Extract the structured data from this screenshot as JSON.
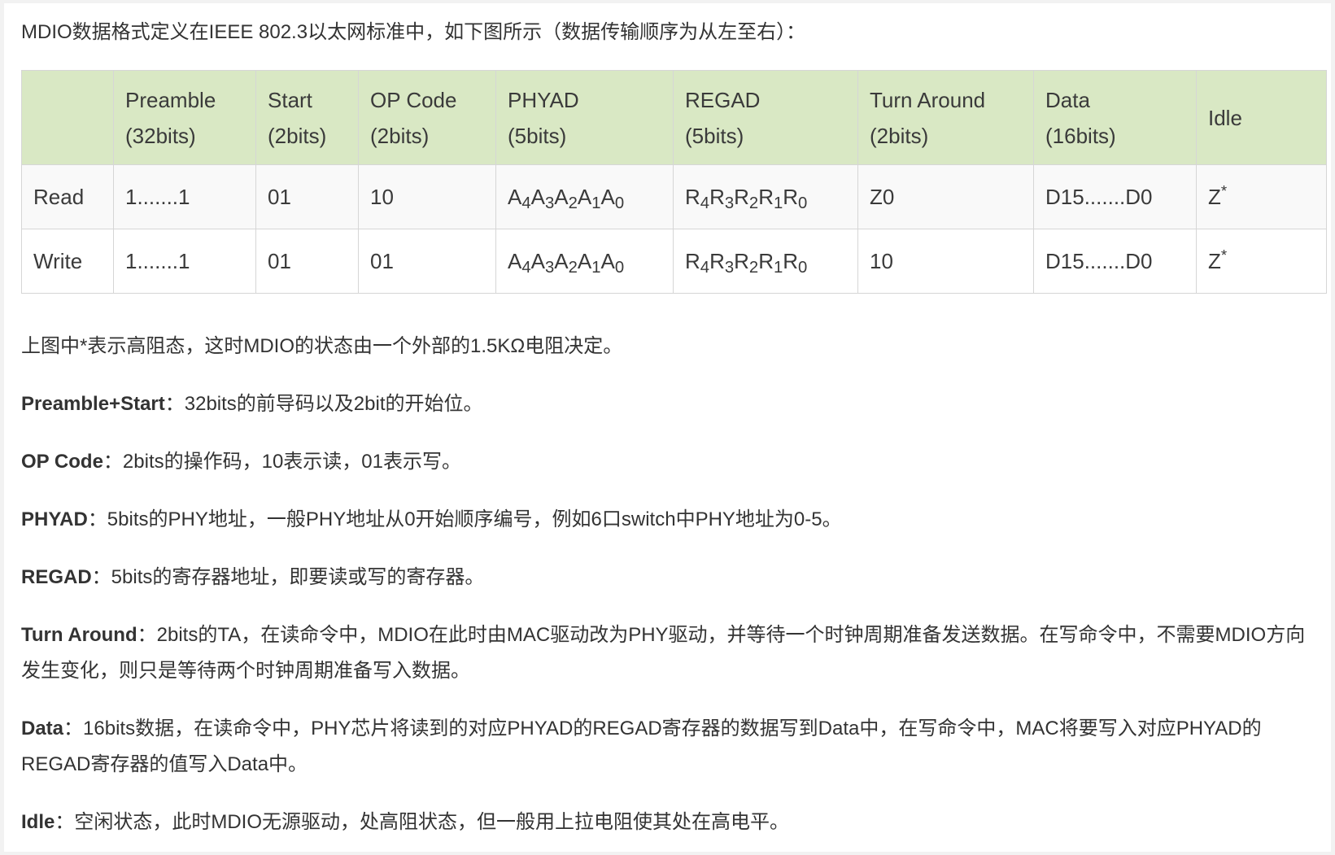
{
  "intro": "MDIO数据格式定义在IEEE 802.3以太网标准中，如下图所示（数据传输顺序为从左至右）：",
  "table": {
    "headers": [
      {
        "line1": "",
        "line2": ""
      },
      {
        "line1": "Preamble",
        "line2": "(32bits)"
      },
      {
        "line1": "Start",
        "line2": "(2bits)"
      },
      {
        "line1": "OP Code",
        "line2": "(2bits)"
      },
      {
        "line1": "PHYAD",
        "line2": "(5bits)"
      },
      {
        "line1": "REGAD",
        "line2": "(5bits)"
      },
      {
        "line1": "Turn Around",
        "line2": "(2bits)"
      },
      {
        "line1": "Data",
        "line2": "(16bits)"
      },
      {
        "line1": "Idle",
        "line2": ""
      }
    ],
    "sub_digits": [
      "4",
      "3",
      "2",
      "1",
      "0"
    ],
    "phyad_letter": "A",
    "regad_letter": "R",
    "idle_z": "Z",
    "idle_star": "*",
    "rows": [
      {
        "op": "Read",
        "preamble": "1.......1",
        "start": "01",
        "opcode": "10",
        "ta": "Z0",
        "data": "D15.......D0"
      },
      {
        "op": "Write",
        "preamble": "1.......1",
        "start": "01",
        "opcode": "01",
        "ta": "10",
        "data": "D15.......D0"
      }
    ]
  },
  "note": "上图中*表示高阻态，这时MDIO的状态由一个外部的1.5KΩ电阻决定。",
  "descriptions": [
    {
      "term": "Preamble+Start",
      "text": "：32bits的前导码以及2bit的开始位。"
    },
    {
      "term": "OP Code",
      "text": "：2bits的操作码，10表示读，01表示写。"
    },
    {
      "term": "PHYAD",
      "text": "：5bits的PHY地址，一般PHY地址从0开始顺序编号，例如6口switch中PHY地址为0-5。"
    },
    {
      "term": "REGAD",
      "text": "：5bits的寄存器地址，即要读或写的寄存器。"
    },
    {
      "term": "Turn Around",
      "text": "：2bits的TA，在读命令中，MDIO在此时由MAC驱动改为PHY驱动，并等待一个时钟周期准备发送数据。在写命令中，不需要MDIO方向发生变化，则只是等待两个时钟周期准备写入数据。"
    },
    {
      "term": "Data",
      "text": "：16bits数据，在读命令中，PHY芯片将读到的对应PHYAD的REGAD寄存器的数据写到Data中，在写命令中，MAC将要写入对应PHYAD的REGAD寄存器的值写入Data中。"
    },
    {
      "term": "Idle",
      "text": "：空闲状态，此时MDIO无源驱动，处高阻状态，但一般用上拉电阻使其处在高电平。"
    }
  ]
}
